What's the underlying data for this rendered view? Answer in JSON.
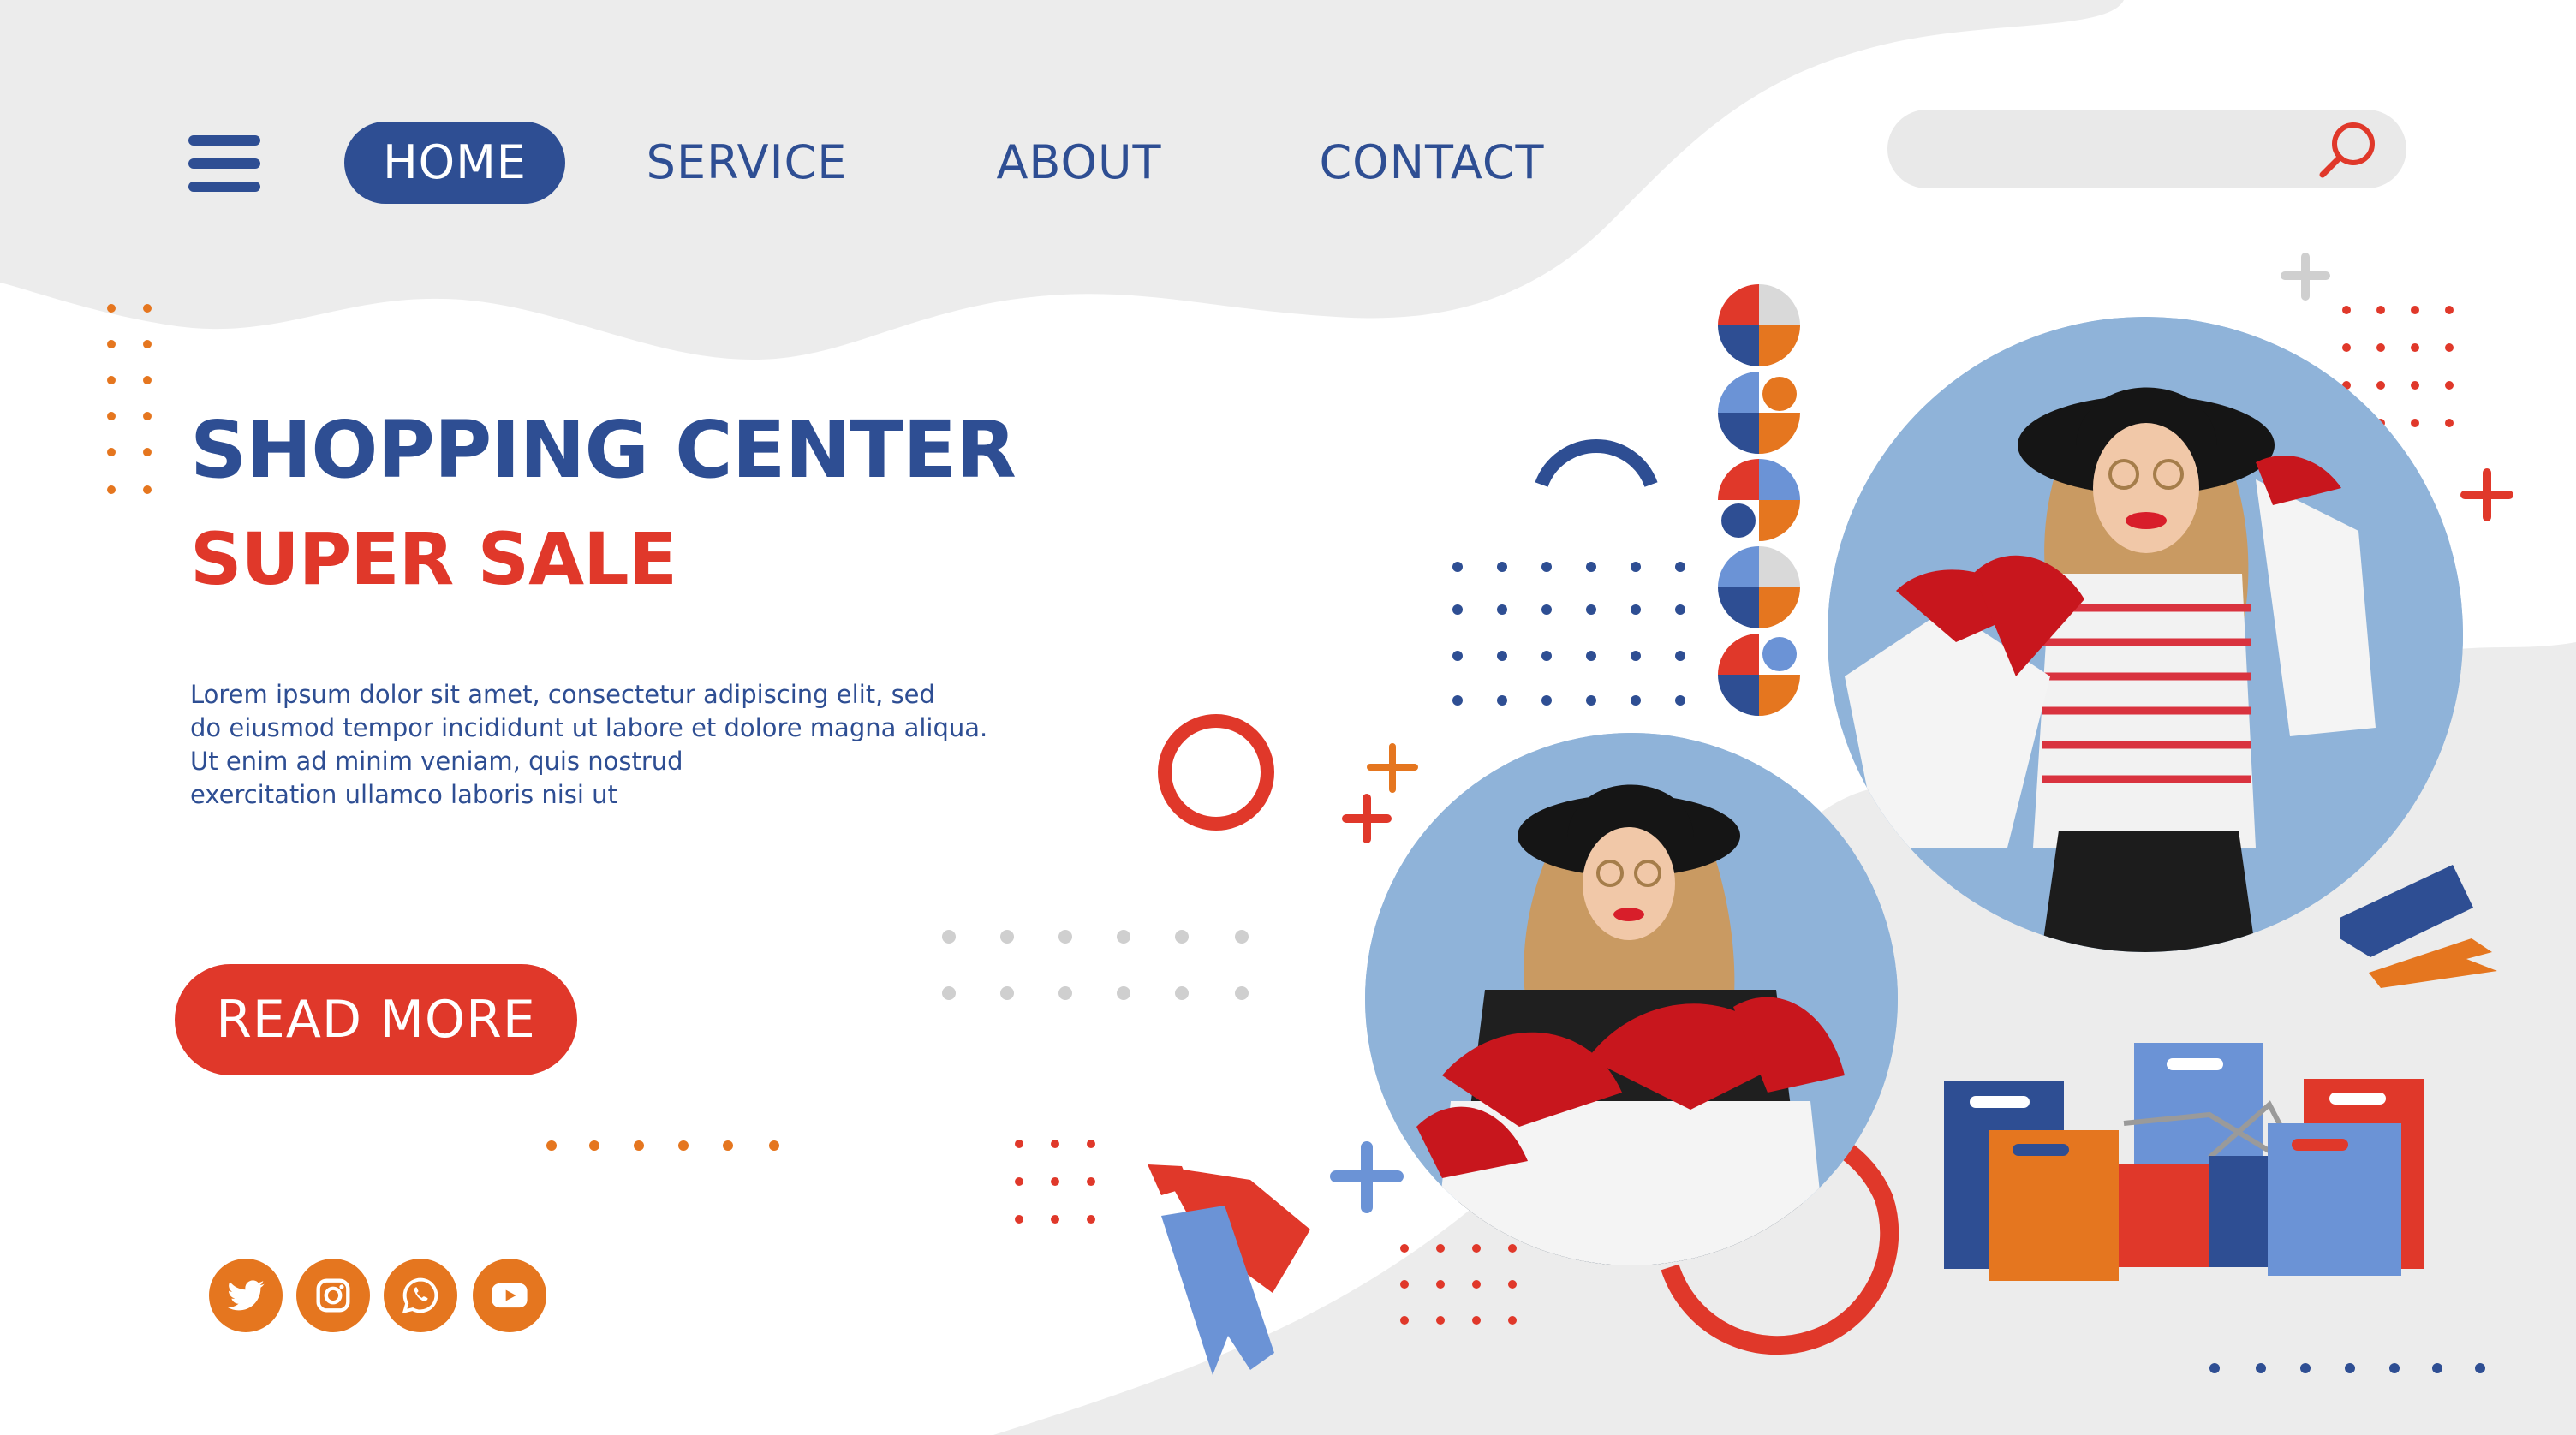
{
  "nav": {
    "items": [
      {
        "label": "HOME",
        "active": true
      },
      {
        "label": "SERVICE",
        "active": false
      },
      {
        "label": "ABOUT",
        "active": false
      },
      {
        "label": "CONTACT",
        "active": false
      }
    ]
  },
  "search": {
    "placeholder": ""
  },
  "hero": {
    "title": "SHOPPING CENTER",
    "subtitle": "SUPER SALE",
    "body_lines": [
      "Lorem ipsum dolor sit amet, consectetur adipiscing elit, sed",
      "do eiusmod tempor incididunt ut labore et dolore magna aliqua.",
      "Ut enim ad minim veniam, quis nostrud",
      "exercitation ullamco laboris nisi ut"
    ],
    "cta_label": "READ MORE"
  },
  "social": [
    "twitter-icon",
    "instagram-icon",
    "whatsapp-icon",
    "youtube-icon"
  ],
  "colors": {
    "primary_blue": "#2e4e93",
    "accent_red": "#e0382a",
    "accent_orange": "#e5761f",
    "light_blue": "#6b93d6",
    "light_gray": "#e9e9e9"
  }
}
